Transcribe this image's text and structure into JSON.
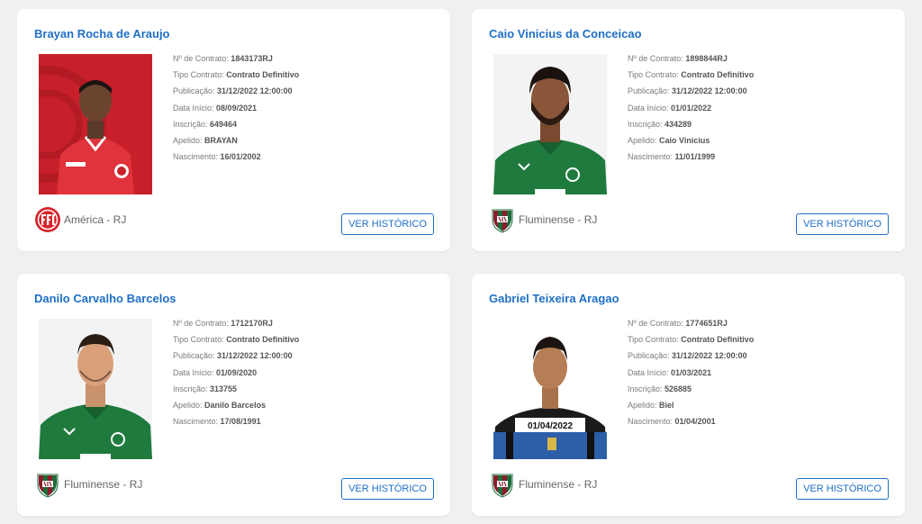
{
  "labels": {
    "contrato": "Nº de Contrato:",
    "tipo": "Tipo Contrato:",
    "publicacao": "Publicação:",
    "inicio": "Data Início:",
    "inscricao": "Inscrição:",
    "apelido": "Apelido:",
    "nascimento": "Nascimento:",
    "button": "VER HISTÓRICO"
  },
  "cards": [
    {
      "name": "Brayan Rocha de Araujo",
      "contrato": "1843173RJ",
      "tipo": "Contrato Definitivo",
      "publicacao": "31/12/2022 12:00:00",
      "inicio": "08/09/2021",
      "inscricao": "649464",
      "apelido": "BRAYAN",
      "nascimento": "16/01/2002",
      "club": "América - RJ",
      "crest_icon": "america-crest-icon",
      "photo_caption": ""
    },
    {
      "name": "Caio Vinicius da Conceicao",
      "contrato": "1898844RJ",
      "tipo": "Contrato Definitivo",
      "publicacao": "31/12/2022 12:00:00",
      "inicio": "01/01/2022",
      "inscricao": "434289",
      "apelido": "Caio Vinicius",
      "nascimento": "11/01/1999",
      "club": "Fluminense - RJ",
      "crest_icon": "fluminense-crest-icon",
      "photo_caption": ""
    },
    {
      "name": "Danilo Carvalho Barcelos",
      "contrato": "1712170RJ",
      "tipo": "Contrato Definitivo",
      "publicacao": "31/12/2022 12:00:00",
      "inicio": "01/09/2020",
      "inscricao": "313755",
      "apelido": "Danilo Barcelos",
      "nascimento": "17/08/1991",
      "club": "Fluminense - RJ",
      "crest_icon": "fluminense-crest-icon",
      "photo_caption": ""
    },
    {
      "name": "Gabriel Teixeira Aragao",
      "contrato": "1774651RJ",
      "tipo": "Contrato Definitivo",
      "publicacao": "31/12/2022 12:00:00",
      "inicio": "01/03/2021",
      "inscricao": "526885",
      "apelido": "Biel",
      "nascimento": "01/04/2001",
      "club": "Fluminense - RJ",
      "crest_icon": "fluminense-crest-icon",
      "photo_caption": "01/04/2022"
    }
  ],
  "colors": {
    "page_bg": "#f0f0f0",
    "card_bg": "#ffffff",
    "accent_blue": "#1f6fc5",
    "america_red": "#d6252c",
    "goias_green": "#1f7a3e",
    "fluminense_green": "#1e6b3a",
    "fluminense_maroon": "#8a1c2b"
  }
}
